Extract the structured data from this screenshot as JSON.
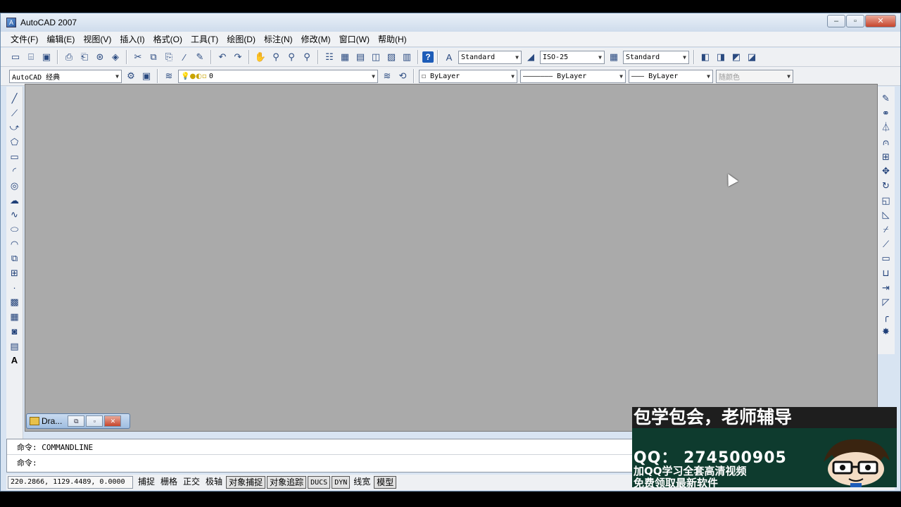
{
  "window": {
    "title": "AutoCAD 2007",
    "minimize": "‒",
    "maximize": "▫",
    "close": "✕"
  },
  "menu": [
    "文件(F)",
    "编辑(E)",
    "视图(V)",
    "插入(I)",
    "格式(O)",
    "工具(T)",
    "绘图(D)",
    "标注(N)",
    "修改(M)",
    "窗口(W)",
    "帮助(H)"
  ],
  "toolbar1": {
    "text_style": "Standard",
    "dim_style": "ISO-25",
    "table_style": "Standard"
  },
  "toolbar2": {
    "workspace": "AutoCAD 经典",
    "layer": "0",
    "color": "ByLayer",
    "linetype": "ByLayer",
    "lineweight": "ByLayer",
    "plot_style": "随颜色"
  },
  "document_tab": {
    "label": "Dra..."
  },
  "command": {
    "line1": "命令: COMMANDLINE",
    "line2": "命令:"
  },
  "status": {
    "coordinates": "220.2866, 1129.4489, 0.0000",
    "buttons": [
      {
        "label": "捕捉",
        "pressed": false
      },
      {
        "label": "栅格",
        "pressed": false
      },
      {
        "label": "正交",
        "pressed": false
      },
      {
        "label": "极轴",
        "pressed": false
      },
      {
        "label": "对象捕捉",
        "pressed": true
      },
      {
        "label": "对象追踪",
        "pressed": true
      },
      {
        "label": "DUCS",
        "pressed": true
      },
      {
        "label": "DYN",
        "pressed": true
      },
      {
        "label": "线宽",
        "pressed": false
      },
      {
        "label": "模型",
        "pressed": true
      }
    ]
  },
  "promo": {
    "title": "包学包会，老师辅导",
    "qq": "QQ： 274500905",
    "line1": "加QQ学习全套高清视频",
    "line2": "免费领取最新软件"
  },
  "colors": {
    "canvas": "#aaaaaa",
    "chrome": "#eef0f3",
    "promo_bg": "#0e3b2e"
  }
}
